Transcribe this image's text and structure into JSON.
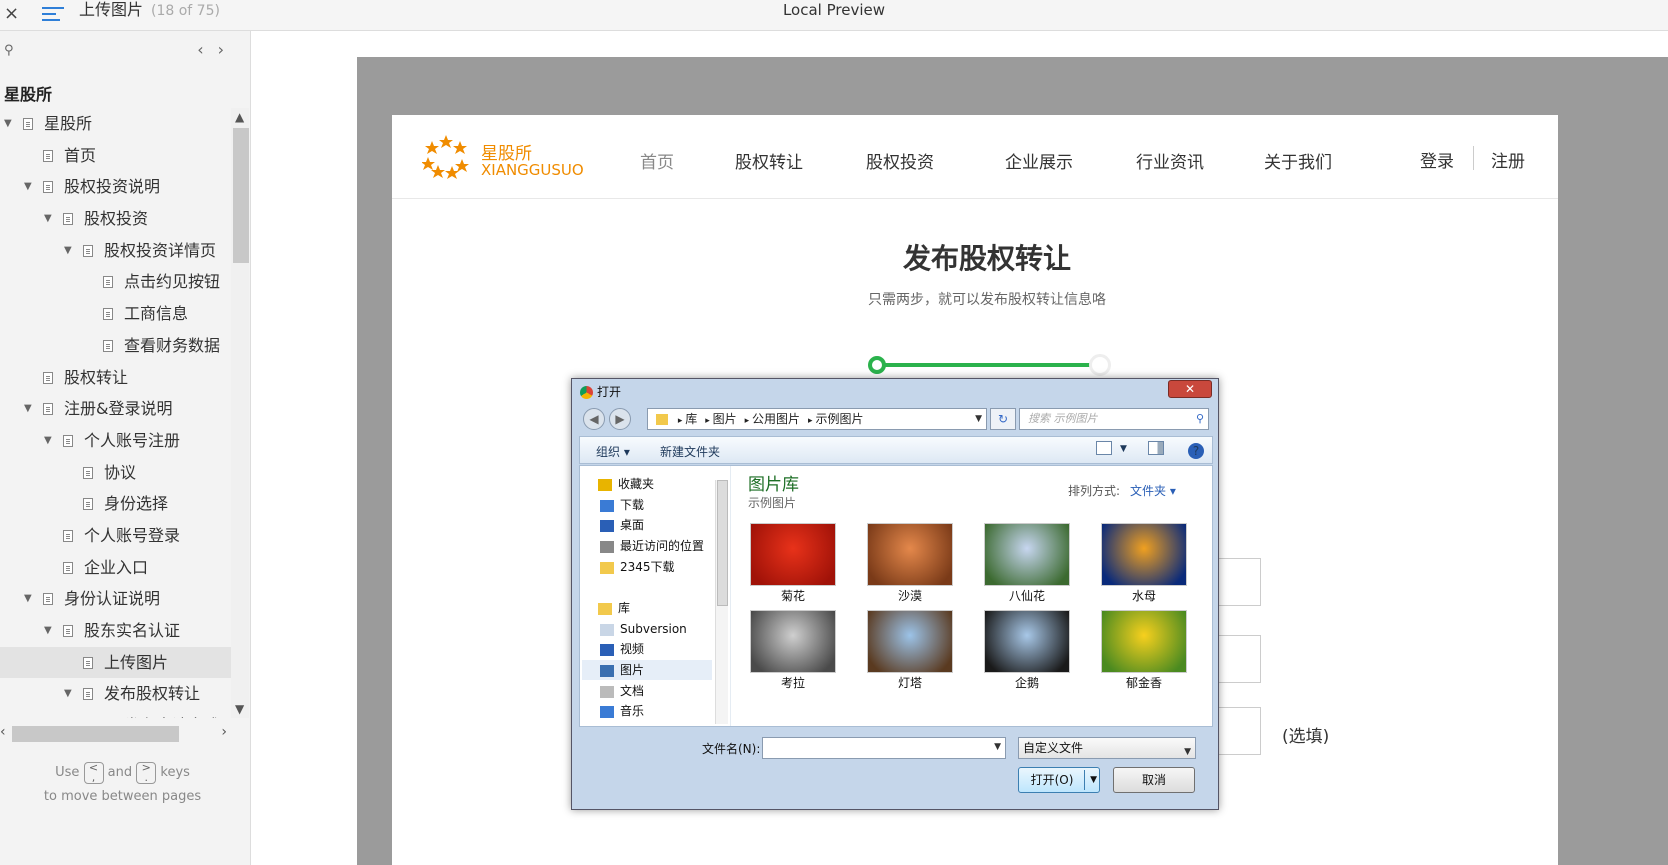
{
  "topbar": {
    "close": "×",
    "page_name": "上传图片",
    "page_count": "(18 of 75)",
    "center_title": "Local Preview"
  },
  "sidebar": {
    "nav_prev": "‹",
    "nav_next": "›",
    "root": "星股所",
    "items": [
      {
        "label": "星股所",
        "caret": true
      },
      {
        "label": "首页",
        "caret": false
      },
      {
        "label": "股权投资说明",
        "caret": true
      },
      {
        "label": "股权投资",
        "caret": true
      },
      {
        "label": "股权投资详情页",
        "caret": true
      },
      {
        "label": "点击约见按钮",
        "caret": false
      },
      {
        "label": "工商信息",
        "caret": false
      },
      {
        "label": "查看财务数据",
        "caret": false
      },
      {
        "label": "股权转让",
        "caret": false
      },
      {
        "label": "注册&登录说明",
        "caret": true
      },
      {
        "label": "个人账号注册",
        "caret": true
      },
      {
        "label": "协议",
        "caret": false
      },
      {
        "label": "身份选择",
        "caret": false
      },
      {
        "label": "个人账号登录",
        "caret": false
      },
      {
        "label": "企业入口",
        "caret": false
      },
      {
        "label": "身份认证说明",
        "caret": true
      },
      {
        "label": "股东实名认证",
        "caret": true
      },
      {
        "label": "上传图片",
        "caret": false,
        "selected": true
      },
      {
        "label": "发布股权转让",
        "caret": true
      },
      {
        "label": "发布申请完成",
        "caret": false
      }
    ],
    "help_use": "Use",
    "help_and": "and",
    "help_keys": "keys",
    "help_line2": "to move between pages",
    "key_prev": "<",
    "key_prev_sub": ",",
    "key_next": ">",
    "key_next_sub": "."
  },
  "site": {
    "logo_cn": "星股所",
    "logo_en": "XIANGGUSUO",
    "brand_color": "#f08c00",
    "nav": [
      "首页",
      "股权转让",
      "股权投资",
      "企业展示",
      "行业资讯",
      "关于我们"
    ],
    "login": "登录",
    "register": "注册",
    "title": "发布股权转让",
    "subtitle": "只需两步，就可以发布股权转让信息咯",
    "optional": "(选填)",
    "step_color": "#2bb24c"
  },
  "dialog": {
    "title": "打开",
    "close": "✕",
    "path": [
      "库",
      "图片",
      "公用图片",
      "示例图片"
    ],
    "search_placeholder": "搜索 示例图片",
    "toolbar_organize": "组织 ▾",
    "toolbar_newfolder": "新建文件夹",
    "nav_items": [
      {
        "label": "收藏夹",
        "group": true
      },
      {
        "label": "下载"
      },
      {
        "label": "桌面"
      },
      {
        "label": "最近访问的位置"
      },
      {
        "label": "2345下载"
      },
      {
        "label": "库",
        "group": true
      },
      {
        "label": "Subversion"
      },
      {
        "label": "视频"
      },
      {
        "label": "图片",
        "selected": true
      },
      {
        "label": "文档"
      },
      {
        "label": "音乐"
      }
    ],
    "library_title": "图片库",
    "library_sub": "示例图片",
    "sort_label": "排列方式:",
    "sort_value": "文件夹 ▾",
    "images": [
      {
        "label": "菊花",
        "c1": "#e8321a",
        "c2": "#a01208"
      },
      {
        "label": "沙漠",
        "c1": "#e4884b",
        "c2": "#7a3a18"
      },
      {
        "label": "八仙花",
        "c1": "#c7d6f0",
        "c2": "#3c6a30"
      },
      {
        "label": "水母",
        "c1": "#f0a020",
        "c2": "#0a2a7a"
      },
      {
        "label": "考拉",
        "c1": "#cfcfcf",
        "c2": "#4a4a4a"
      },
      {
        "label": "灯塔",
        "c1": "#9cc3e8",
        "c2": "#5a3a20"
      },
      {
        "label": "企鹅",
        "c1": "#a8c8e8",
        "c2": "#1a1a1a"
      },
      {
        "label": "郁金香",
        "c1": "#f7d01e",
        "c2": "#4a8a20"
      }
    ],
    "filename_label": "文件名(N):",
    "filename_value": "",
    "filetype": "自定义文件",
    "open_button": "打开(O)",
    "cancel_button": "取消"
  }
}
